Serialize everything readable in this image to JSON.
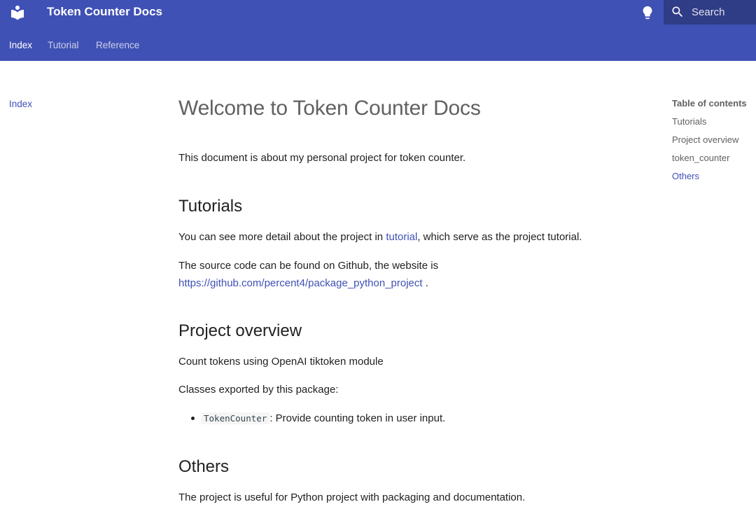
{
  "header": {
    "title": "Token Counter Docs",
    "search_placeholder": "Search",
    "colors": {
      "primary": "#4051b5",
      "link": "#4051b5"
    }
  },
  "tabs": [
    {
      "label": "Index"
    },
    {
      "label": "Tutorial"
    },
    {
      "label": "Reference"
    }
  ],
  "left_nav": {
    "items": [
      {
        "label": "Index"
      }
    ]
  },
  "toc": {
    "title": "Table of contents",
    "items": [
      {
        "label": "Tutorials"
      },
      {
        "label": "Project overview"
      },
      {
        "label": "token_counter"
      },
      {
        "label": "Others"
      }
    ]
  },
  "content": {
    "title": "Welcome to Token Counter Docs",
    "intro": "This document is about my personal project for token counter.",
    "tutorials": {
      "heading": "Tutorials",
      "p1_before": "You can see more detail about the project in ",
      "p1_link": "tutorial",
      "p1_after": ", which serve as the project tutorial.",
      "p2_text": "The source code can be found on Github, the website is",
      "p2_link": "https://github.com/percent4/package_python_project",
      "p2_after": " ."
    },
    "overview": {
      "heading": "Project overview",
      "p1": "Count tokens using OpenAI tiktoken module",
      "p2": "Classes exported by this package:",
      "bullet_code": "TokenCounter",
      "bullet_text": ": Provide counting token in user input."
    },
    "others": {
      "heading": "Others",
      "p1": "The project is useful for Python project with packaging and documentation."
    }
  }
}
